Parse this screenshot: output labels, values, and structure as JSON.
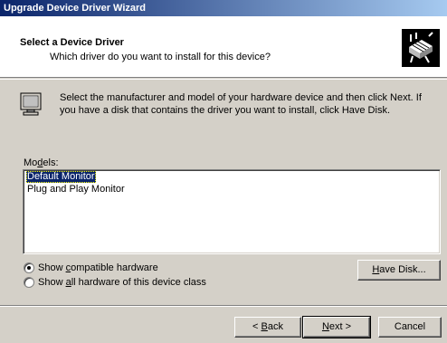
{
  "window": {
    "title": "Upgrade Device Driver Wizard"
  },
  "header": {
    "title": "Select a Device Driver",
    "subtitle": "Which driver do you want to install for this device?"
  },
  "intro": {
    "text": "Select the manufacturer and model of your hardware device and then click Next. If you have a disk that contains the driver you want to install, click Have Disk."
  },
  "models": {
    "label_pre": "Mo",
    "label_ul": "d",
    "label_post": "els:",
    "items": [
      "Default Monitor",
      "Plug and Play Monitor"
    ],
    "selected_index": 0
  },
  "options": {
    "compatible": {
      "pre": "Show ",
      "ul": "c",
      "post": "ompatible hardware",
      "checked": true
    },
    "all": {
      "pre": "Show ",
      "ul": "a",
      "post": "ll hardware of this device class",
      "checked": false
    }
  },
  "buttons": {
    "have_disk": {
      "ul": "H",
      "post": "ave Disk..."
    },
    "back": {
      "pre": "< ",
      "ul": "B",
      "post": "ack"
    },
    "next": {
      "ul": "N",
      "post": "ext >"
    },
    "cancel": "Cancel"
  },
  "colors": {
    "titlebar_start": "#0a246a",
    "titlebar_end": "#a6caf0",
    "face": "#d4d0c8",
    "selection": "#0a246a"
  },
  "icons": {
    "header": "hardware-chip-icon",
    "intro": "monitor-icon"
  }
}
